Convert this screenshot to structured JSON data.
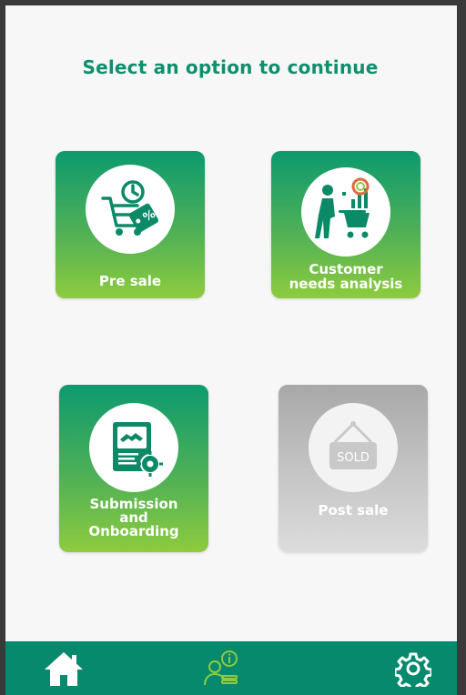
{
  "page": {
    "title": "Select an option to continue"
  },
  "options": [
    {
      "label": "Pre sale",
      "icon": "cart-discount-icon",
      "enabled": true
    },
    {
      "label_line1": "Customer",
      "label_line2": "needs analysis",
      "icon": "customer-analysis-icon",
      "enabled": true
    },
    {
      "label_line1": "Submission",
      "label_line2": "and",
      "label_line3": "Onboarding",
      "icon": "handshake-document-icon",
      "enabled": true
    },
    {
      "label": "Post sale",
      "icon": "sold-sign-icon",
      "icon_text": "SOLD",
      "enabled": false
    }
  ],
  "navbar": {
    "items": [
      {
        "icon": "home-icon"
      },
      {
        "icon": "user-info-icon"
      },
      {
        "icon": "gear-icon"
      }
    ]
  },
  "colors": {
    "accent": "#0f8f6e",
    "navbar": "#07896d",
    "tile_top": "#0d9a6f",
    "tile_bottom": "#8ecb3e",
    "disabled_tile": "#c6c6c6",
    "active_nav_icon": "#8ecb3e"
  }
}
